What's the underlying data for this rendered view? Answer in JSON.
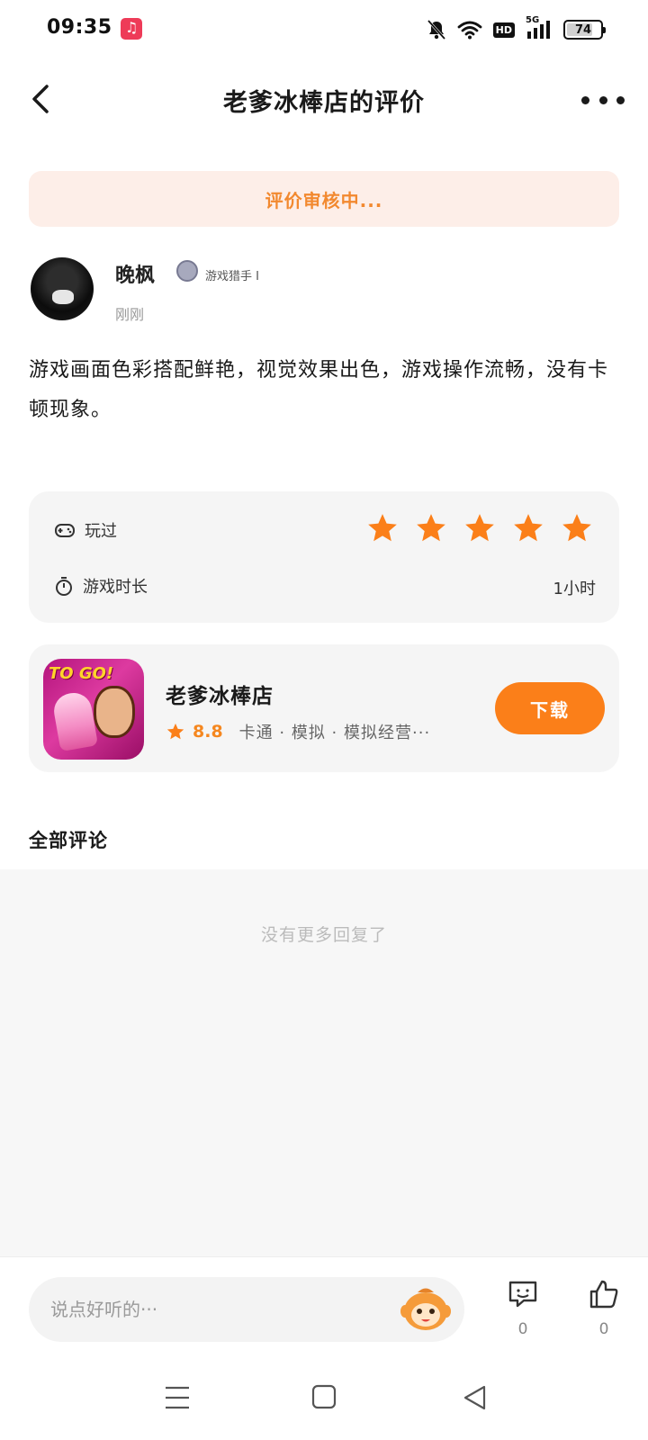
{
  "status_bar": {
    "time": "09:35",
    "battery": "74",
    "hd_label": "HD",
    "network_label": "5G",
    "icons": [
      "music-app-icon",
      "mute-bell-icon",
      "wifi-icon",
      "hd-icon",
      "signal-5g-icon",
      "battery-icon"
    ]
  },
  "header": {
    "title": "老爹冰棒店的评价"
  },
  "banner": {
    "text": "评价审核中..."
  },
  "user": {
    "name": "晚枫",
    "badge_text": "游戏猎手 I",
    "time": "刚刚"
  },
  "review": {
    "text": "游戏画面色彩搭配鲜艳，视觉效果出色，游戏操作流畅，没有卡顿现象。"
  },
  "rating": {
    "played_label": "玩过",
    "stars": 5,
    "stars_max": 5,
    "duration_label": "游戏时长",
    "duration_value": "1小时",
    "star_color": "#fb7f19"
  },
  "game": {
    "icon_text": "TO GO!",
    "name": "老爹冰棒店",
    "score": "8.8",
    "tags": "卡通 · 模拟 · 模拟经营···",
    "download_label": "下载",
    "accent": "#fb7f19"
  },
  "comments": {
    "title": "全部评论",
    "empty_text": "没有更多回复了"
  },
  "bottom_bar": {
    "placeholder": "说点好听的···",
    "comment_count": "0",
    "like_count": "0"
  },
  "nav": {
    "items": [
      "menu-icon",
      "home-icon",
      "back-triangle-icon"
    ]
  }
}
